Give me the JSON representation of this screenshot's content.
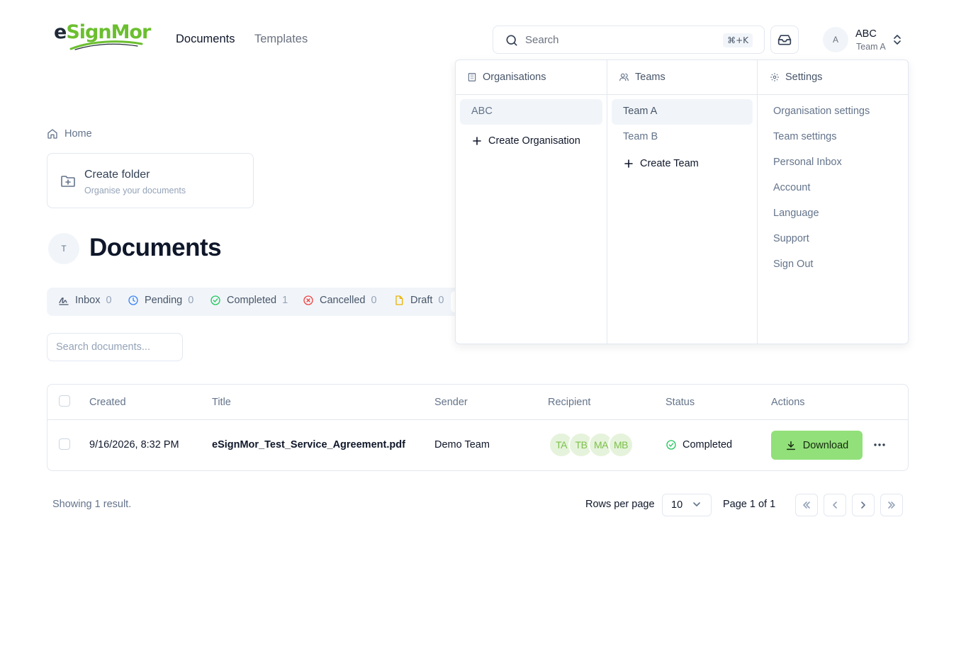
{
  "header": {
    "logo_text_a": "e",
    "logo_text_b": "Sign",
    "logo_text_c": "Mor",
    "nav": {
      "documents": "Documents",
      "templates": "Templates"
    },
    "search": {
      "placeholder": "Search",
      "shortcut": "⌘+K"
    },
    "user": {
      "avatar_initial": "A",
      "name": "ABC",
      "team": "Team A"
    }
  },
  "breadcrumb": {
    "home": "Home"
  },
  "folder_card": {
    "title": "Create folder",
    "subtitle": "Organise your documents"
  },
  "page": {
    "team_initial": "T",
    "title": "Documents"
  },
  "tabs": [
    {
      "label": "Inbox",
      "count": "0"
    },
    {
      "label": "Pending",
      "count": "0"
    },
    {
      "label": "Completed",
      "count": "1"
    },
    {
      "label": "Cancelled",
      "count": "0"
    },
    {
      "label": "Draft",
      "count": "0"
    }
  ],
  "doc_search": {
    "placeholder": "Search documents..."
  },
  "table": {
    "columns": [
      "Created",
      "Title",
      "Sender",
      "Recipient",
      "Status",
      "Actions"
    ],
    "rows": [
      {
        "created": "9/16/2026, 8:32 PM",
        "title": "eSignMor_Test_Service_Agreement.pdf",
        "sender": "Demo Team",
        "recipients": [
          "TA",
          "TB",
          "MA",
          "MB"
        ],
        "status": "Completed",
        "action": "Download"
      }
    ]
  },
  "footer": {
    "showing": "Showing 1 result.",
    "rows_per_page_label": "Rows per page",
    "rows_per_page_value": "10",
    "page_of": "Page 1 of 1"
  },
  "menu": {
    "organisations": {
      "header": "Organisations",
      "items": [
        "ABC"
      ],
      "create": "Create Organisation"
    },
    "teams": {
      "header": "Teams",
      "items": [
        "Team A",
        "Team B"
      ],
      "create": "Create Team"
    },
    "settings": {
      "header": "Settings",
      "items": [
        "Organisation settings",
        "Team settings",
        "Personal Inbox",
        "Account",
        "Language",
        "Support",
        "Sign Out"
      ]
    }
  },
  "colors": {
    "brand_green": "#6bbf2f",
    "download_button": "#92e07a",
    "completed_icon": "#22c55e",
    "cancelled_icon": "#ef4444",
    "pending_icon": "#3b82f6",
    "draft_icon": "#eab308"
  },
  "icons": [
    "search-icon",
    "inbox-icon",
    "chevrons-up-down-icon",
    "home-icon",
    "folder-plus-icon",
    "signature-icon",
    "clock-icon",
    "check-circle-icon",
    "x-circle-icon",
    "file-icon",
    "download-icon",
    "more-horizontal-icon",
    "chevrons-left-icon",
    "chevron-left-icon",
    "chevron-right-icon",
    "chevrons-right-icon",
    "building-icon",
    "users-icon",
    "gear-icon",
    "plus-icon"
  ]
}
